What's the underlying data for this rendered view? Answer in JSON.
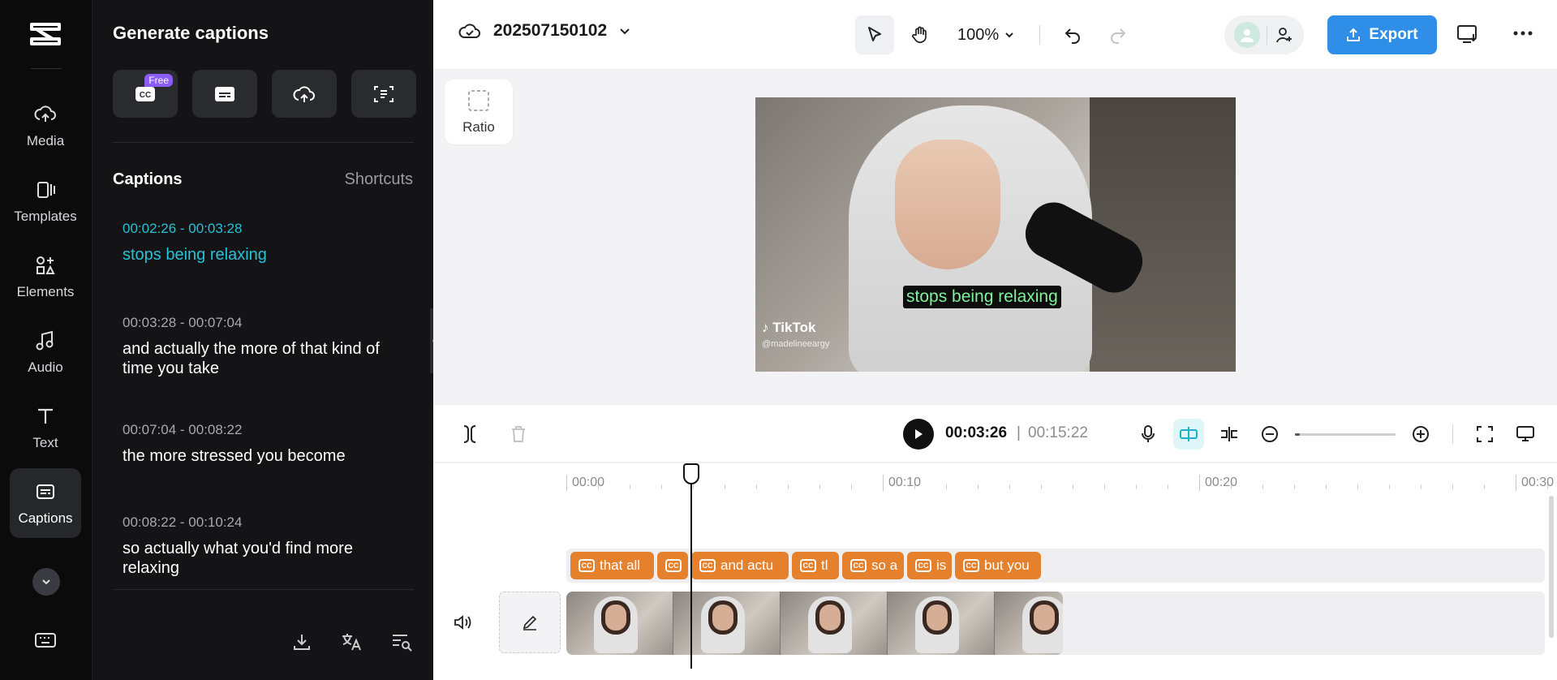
{
  "rail": {
    "items": [
      {
        "label": "Media",
        "icon": "cloud-upload-icon"
      },
      {
        "label": "Templates",
        "icon": "templates-icon"
      },
      {
        "label": "Elements",
        "icon": "elements-icon"
      },
      {
        "label": "Audio",
        "icon": "music-note-icon"
      },
      {
        "label": "Text",
        "icon": "text-t-icon"
      },
      {
        "label": "Captions",
        "icon": "captions-icon",
        "active": true
      }
    ]
  },
  "panel": {
    "title": "Generate captions",
    "free_badge": "Free",
    "captions_heading": "Captions",
    "shortcuts_label": "Shortcuts",
    "captions": [
      {
        "time": "00:02:26 - 00:03:28",
        "text": "stops being relaxing"
      },
      {
        "time": "00:03:28 - 00:07:04",
        "text": "and actually the more of that kind of time you take"
      },
      {
        "time": "00:07:04 - 00:08:22",
        "text": "the more stressed you become"
      },
      {
        "time": "00:08:22 - 00:10:24",
        "text": "so actually what you'd find more relaxing"
      }
    ]
  },
  "topbar": {
    "project_name": "202507150102",
    "zoom": "100%",
    "export_label": "Export"
  },
  "canvas": {
    "ratio_label": "Ratio",
    "subtitle": "stops being relaxing",
    "watermark": "TikTok",
    "watermark_handle": "@madelineeargy"
  },
  "playback": {
    "current_time": "00:03:26",
    "separator": "|",
    "total_time": "00:15:22",
    "zoom_level": 0.0
  },
  "timeline": {
    "ruler": [
      "00:00",
      "00:10",
      "00:20",
      "00:30"
    ],
    "caption_clips": [
      "that all",
      "",
      "and actu",
      "tl",
      "so a",
      "is",
      "but you"
    ]
  },
  "colors": {
    "accent": "#2f8fe8",
    "active_caption": "#27c1d8",
    "caption_clip": "#e5812c",
    "subtitle_text": "#7ff29a"
  }
}
